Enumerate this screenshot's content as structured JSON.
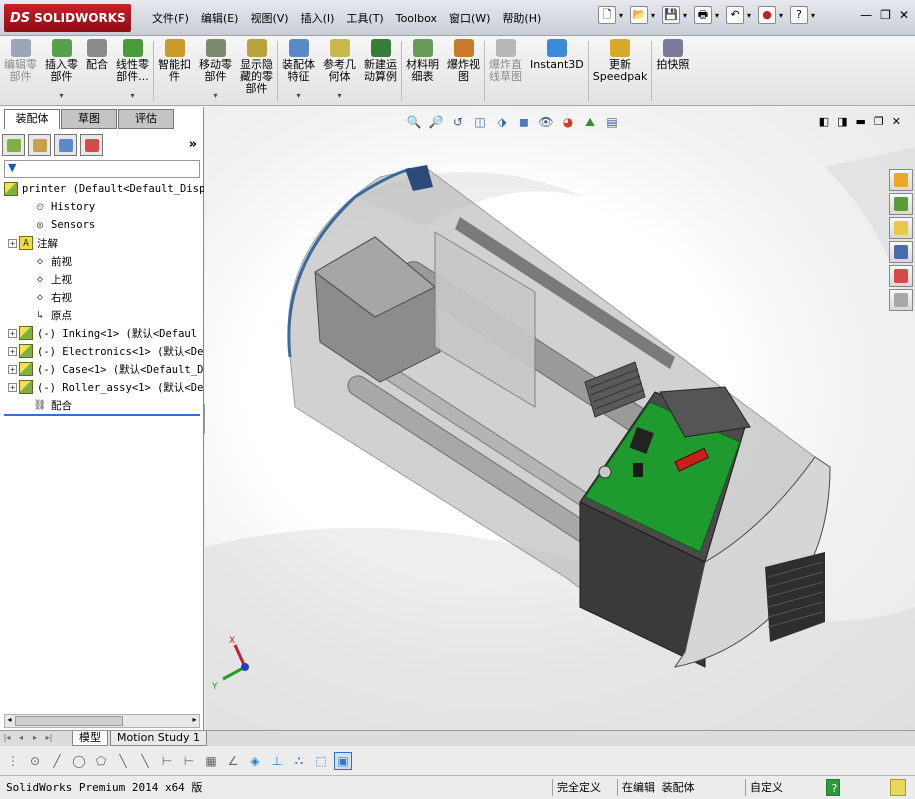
{
  "app": {
    "logo_mark": "DS",
    "logo_text": "SOLIDWORKS"
  },
  "menu": [
    "文件(F)",
    "编辑(E)",
    "视图(V)",
    "插入(I)",
    "工具(T)",
    "Toolbox",
    "窗口(W)",
    "帮助(H)"
  ],
  "quick_icons": [
    "new-document-icon",
    "open-folder-icon",
    "save-icon",
    "print-icon",
    "undo-icon",
    "rebuild-traffic-light-icon",
    "help-icon"
  ],
  "window_controls": [
    "minimize-icon",
    "restore-icon",
    "close-icon"
  ],
  "ribbon": [
    {
      "label": "编辑零\n部件",
      "disabled": true,
      "dropdown": false,
      "color": "#9aa7b8"
    },
    {
      "label": "插入零\n部件",
      "disabled": false,
      "dropdown": true,
      "color": "#5aa04a"
    },
    {
      "label": "配合",
      "disabled": false,
      "dropdown": false,
      "color": "#8a8a8a"
    },
    {
      "label": "线性零\n部件...",
      "disabled": false,
      "dropdown": true,
      "color": "#4a9a3a"
    },
    {
      "label": "智能扣\n件",
      "disabled": false,
      "dropdown": false,
      "color": "#c89a2a"
    },
    {
      "label": "移动零\n部件",
      "disabled": false,
      "dropdown": true,
      "color": "#7a8a6a"
    },
    {
      "label": "显示隐\n藏的零\n部件",
      "disabled": false,
      "dropdown": false,
      "color": "#b8a43a"
    },
    {
      "label": "装配体\n特征",
      "disabled": false,
      "dropdown": true,
      "color": "#5a8aca"
    },
    {
      "label": "参考几\n何体",
      "disabled": false,
      "dropdown": true,
      "color": "#c8b84a"
    },
    {
      "label": "新建运\n动算例",
      "disabled": false,
      "dropdown": false,
      "color": "#3a7a3a"
    },
    {
      "label": "材料明\n细表",
      "disabled": false,
      "dropdown": false,
      "color": "#6a9a5a"
    },
    {
      "label": "爆炸视\n图",
      "disabled": false,
      "dropdown": false,
      "color": "#c87a2a"
    },
    {
      "label": "爆炸直\n线草图",
      "disabled": true,
      "dropdown": false,
      "color": "#b8b8b8"
    },
    {
      "label": "Instant3D",
      "disabled": false,
      "dropdown": false,
      "color": "#3a8ad8"
    },
    {
      "label": "更新\nSpeedpak",
      "disabled": false,
      "dropdown": false,
      "color": "#d8a82a"
    },
    {
      "label": "拍快照",
      "disabled": false,
      "dropdown": false,
      "color": "#7a7a9a"
    }
  ],
  "cm_tabs": [
    "装配体",
    "草图",
    "评估"
  ],
  "fm_tabs": [
    "featuremanager-tree-icon",
    "property-manager-icon",
    "configuration-manager-icon",
    "display-manager-icon"
  ],
  "tree": [
    {
      "label": "printer  (Default<Default_Disp",
      "icon": "assembly-icon",
      "expand": "",
      "indent": 4
    },
    {
      "label": "History",
      "icon": "history-icon",
      "expand": "none",
      "indent": 22
    },
    {
      "label": "Sensors",
      "icon": "sensors-icon",
      "expand": "none",
      "indent": 22
    },
    {
      "label": "注解",
      "icon": "annotations-icon",
      "expand": "+",
      "indent": 8
    },
    {
      "label": "前视",
      "icon": "plane-icon",
      "expand": "none",
      "indent": 22
    },
    {
      "label": "上视",
      "icon": "plane-icon",
      "expand": "none",
      "indent": 22
    },
    {
      "label": "右视",
      "icon": "plane-icon",
      "expand": "none",
      "indent": 22
    },
    {
      "label": "原点",
      "icon": "origin-icon",
      "expand": "none",
      "indent": 22
    },
    {
      "label": "(-) Inking<1> (默认<Defaul",
      "icon": "assembly-icon",
      "expand": "+",
      "indent": 8
    },
    {
      "label": "(-) Electronics<1> (默认<De",
      "icon": "assembly-icon",
      "expand": "+",
      "indent": 8
    },
    {
      "label": "(-) Case<1> (默认<Default_D",
      "icon": "assembly-icon",
      "expand": "+",
      "indent": 8
    },
    {
      "label": "(-) Roller_assy<1> (默认<De",
      "icon": "assembly-icon",
      "expand": "+",
      "indent": 8
    },
    {
      "label": "配合",
      "icon": "mates-icon",
      "expand": "none",
      "indent": 22
    }
  ],
  "headsup": [
    "zoom-to-fit-icon",
    "zoom-area-icon",
    "previous-view-icon",
    "section-view-icon",
    "view-orientation-icon",
    "display-style-icon",
    "hide-show-icon",
    "edit-appearance-icon",
    "apply-scene-icon",
    "view-settings-icon"
  ],
  "taskpane": [
    "resources-icon",
    "design-library-icon",
    "file-explorer-icon",
    "view-palette-icon",
    "appearances-icon",
    "custom-properties-icon"
  ],
  "triad": {
    "x": "X",
    "y": "Y"
  },
  "bottom_tabs": [
    "模型",
    "Motion Study 1"
  ],
  "sketch_tools": [
    "grid-icon",
    "point-icon",
    "line-icon",
    "circle-icon",
    "polygon-icon",
    "slash-icon",
    "slash-icon",
    "dim-icon",
    "dim-icon",
    "hatch-icon",
    "angle-icon",
    "cube-icon",
    "anchor-icon",
    "camera-icon",
    "box-icon",
    "solid-cube-icon"
  ],
  "status": {
    "version": "SolidWorks Premium 2014 x64 版",
    "defined": "完全定义",
    "editing": "在编辑 装配体",
    "units": "自定义",
    "help": "?",
    "colors": {
      "pcb": "#1f9a2e",
      "chassis": "#3a3a3a",
      "shell": "#d9d9d9"
    }
  }
}
